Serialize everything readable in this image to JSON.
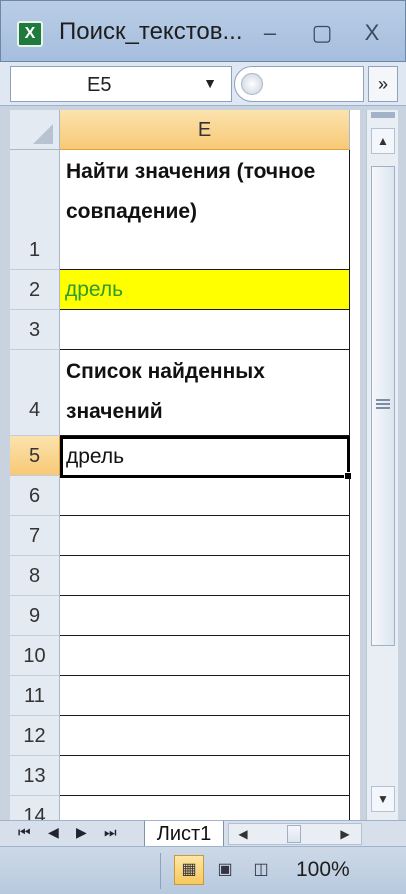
{
  "window": {
    "title": "Поиск_текстов...",
    "app_icon": "excel-icon",
    "controls": {
      "minimize": "–",
      "maximize": "▢",
      "close": "X"
    }
  },
  "formula_bar": {
    "name_box": "E5",
    "name_box_arrow": "▼",
    "expand_glyph": "»"
  },
  "grid": {
    "column_header": "E",
    "rows": [
      {
        "num": "1",
        "text": "Найти значения (точное совпадение)"
      },
      {
        "num": "2",
        "text": "дрель"
      },
      {
        "num": "3",
        "text": ""
      },
      {
        "num": "4",
        "text": "Список найденных значений"
      },
      {
        "num": "5",
        "text": "дрель"
      },
      {
        "num": "6",
        "text": ""
      },
      {
        "num": "7",
        "text": ""
      },
      {
        "num": "8",
        "text": ""
      },
      {
        "num": "9",
        "text": ""
      },
      {
        "num": "10",
        "text": ""
      },
      {
        "num": "11",
        "text": ""
      },
      {
        "num": "12",
        "text": ""
      },
      {
        "num": "13",
        "text": ""
      },
      {
        "num": "14",
        "text": ""
      }
    ],
    "highlight_color": "#ffff00",
    "highlight_text_color": "#2e9b2e",
    "selected_cell": "E5"
  },
  "tabs": {
    "sheet_name": "Лист1",
    "nav": [
      "⏮",
      "◀",
      "▶",
      "⏭"
    ]
  },
  "status_bar": {
    "zoom": "100%",
    "views": [
      "normal-view-icon",
      "page-layout-icon",
      "page-break-icon"
    ]
  }
}
